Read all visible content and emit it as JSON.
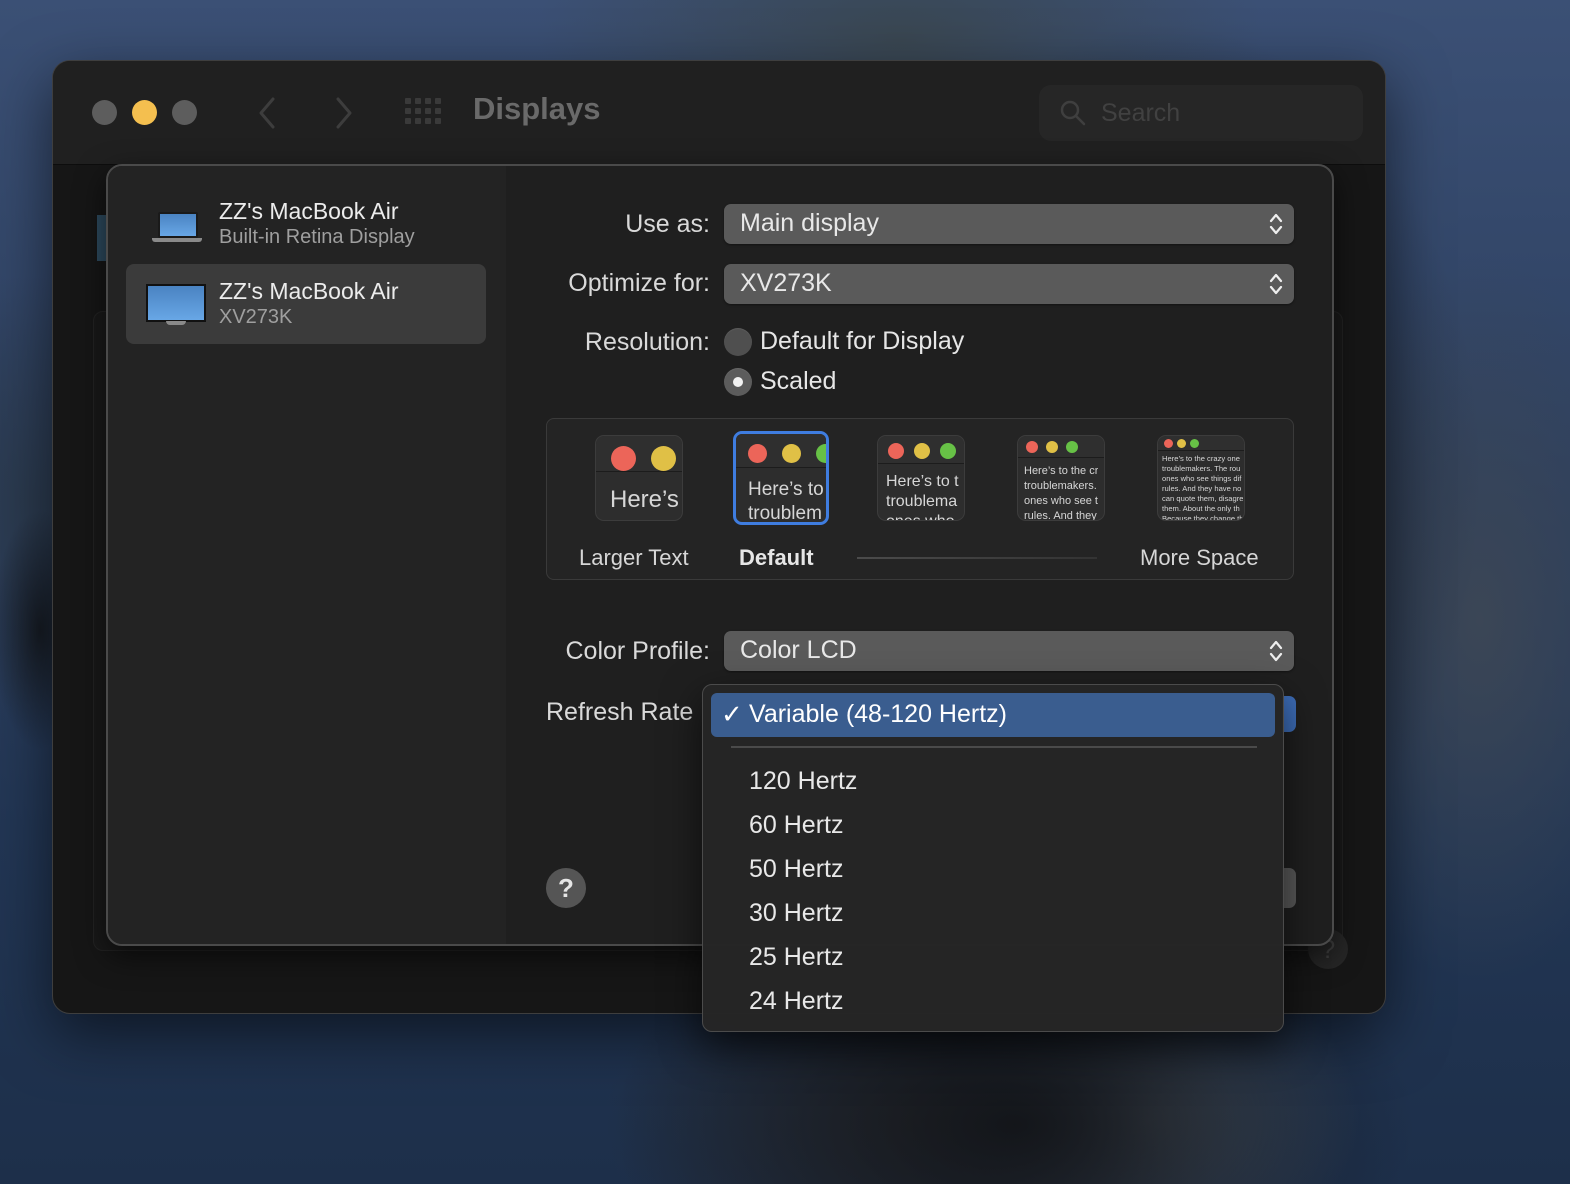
{
  "window": {
    "title": "Displays",
    "search_placeholder": "Search"
  },
  "sidebar": {
    "displays": [
      {
        "name": "ZZ's MacBook Air",
        "subtitle": "Built-in Retina Display",
        "icon": "laptop-icon",
        "selected": false
      },
      {
        "name": "ZZ's MacBook Air",
        "subtitle": "XV273K",
        "icon": "monitor-icon",
        "selected": true
      }
    ]
  },
  "settings": {
    "use_as": {
      "label": "Use as:",
      "value": "Main display"
    },
    "optimize_for": {
      "label": "Optimize for:",
      "value": "XV273K"
    },
    "resolution": {
      "label": "Resolution:",
      "options": [
        {
          "label": "Default for Display",
          "selected": false
        },
        {
          "label": "Scaled",
          "selected": true
        }
      ]
    },
    "scaled_options": {
      "labels": [
        "Larger Text",
        "Default",
        "",
        "",
        "More Space"
      ],
      "selected_index": 1,
      "preview_texts": [
        "Here’s",
        "Here’s to\ntroublem",
        "Here’s to t\ntroublema\nones who",
        "Here’s to the cr\ntroublemakers.\nones who see t\nrules. And they",
        "Here’s to the crazy one\ntroublemakers. The rou\nones who see things dif\nrules. And they have no\ncan quote them, disagre\nthem. About the only th\nBecause they change th"
      ]
    },
    "color_profile": {
      "label": "Color Profile:",
      "value": "Color LCD"
    },
    "refresh_rate": {
      "label": "Refresh Rate"
    },
    "help_label": "?"
  },
  "refresh_menu": {
    "check_glyph": "✓",
    "items": [
      {
        "label": "Variable (48-120 Hertz)",
        "selected": true
      },
      {
        "label": "120 Hertz",
        "selected": false
      },
      {
        "label": "60 Hertz",
        "selected": false
      },
      {
        "label": "50 Hertz",
        "selected": false
      },
      {
        "label": "30 Hertz",
        "selected": false
      },
      {
        "label": "25 Hertz",
        "selected": false
      },
      {
        "label": "24 Hertz",
        "selected": false
      }
    ]
  },
  "colors": {
    "accent": "#3f7de0",
    "menu_highlight": "#3a5d8f",
    "traffic_minimize": "#f4bf4f"
  }
}
